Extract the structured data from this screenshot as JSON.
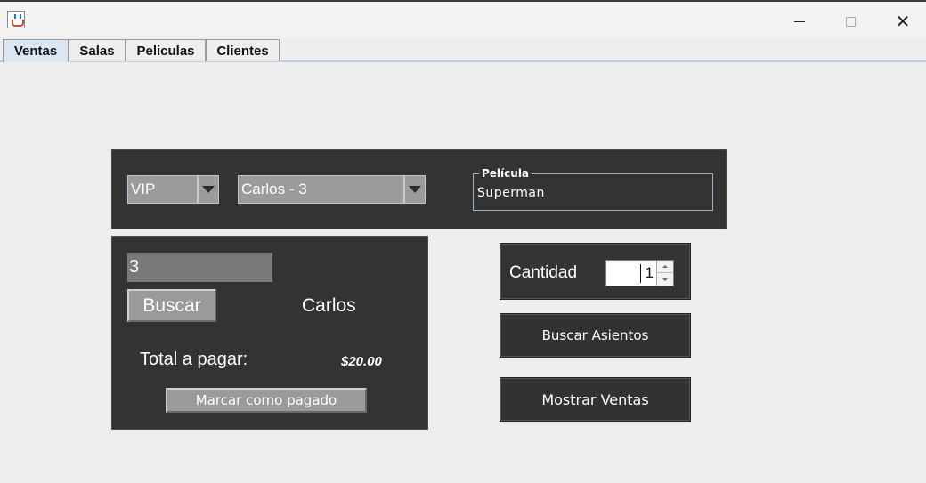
{
  "window": {
    "title": "",
    "icon": "java-cup-icon"
  },
  "tabs": [
    {
      "label": "Ventas",
      "active": true
    },
    {
      "label": "Salas",
      "active": false
    },
    {
      "label": "Peliculas",
      "active": false
    },
    {
      "label": "Clientes",
      "active": false
    }
  ],
  "ventas": {
    "sala_type_combo": {
      "value": "VIP"
    },
    "client_combo": {
      "value": "Carlos - 3"
    },
    "pelicula": {
      "legend": "Película",
      "value": "Superman"
    },
    "client_search": {
      "id_value": "3",
      "search_button": "Buscar",
      "client_name": "Carlos",
      "total_label": "Total a pagar:",
      "total_value": "$20.00",
      "mark_paid_button": "Marcar como pagado"
    },
    "cantidad": {
      "label": "Cantidad",
      "value": "1"
    },
    "buscar_asientos_button": "Buscar Asientos",
    "mostrar_ventas_button": "Mostrar Ventas"
  },
  "colors": {
    "panel_bg": "#333333",
    "control_gray": "#9b9b9b",
    "window_bg": "#eeeeee",
    "active_tab": "#dbe6f3"
  }
}
